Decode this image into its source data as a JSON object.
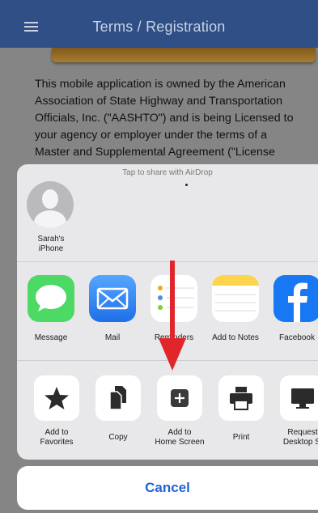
{
  "navbar": {
    "title": "Terms / Registration"
  },
  "terms": {
    "paragraph": "This mobile application is owned by the American Association of State Highway and Transportation Officials, Inc. (\"AASHTO\") and is being Licensed to your agency or employer under the terms of a Master and Supplemental Agreement (\"License"
  },
  "share_sheet": {
    "airdrop_title": "Tap to share with AirDrop",
    "contact": {
      "line1": "Sarah's",
      "line2": "iPhone"
    },
    "apps": [
      {
        "label": "Message",
        "color": "#4cd964"
      },
      {
        "label": "Mail",
        "color": "#2f7df6"
      },
      {
        "label": "Reminders",
        "color": "#ffffff"
      },
      {
        "label": "Add to Notes",
        "color": "#ffffff"
      },
      {
        "label": "Facebook",
        "color": "#1877f2"
      }
    ],
    "actions": [
      {
        "line1": "Add to",
        "line2": "Favorites"
      },
      {
        "line1": "Copy",
        "line2": ""
      },
      {
        "line1": "Add to",
        "line2": "Home Screen"
      },
      {
        "line1": "Print",
        "line2": ""
      },
      {
        "line1": "Request",
        "line2": "Desktop Si"
      }
    ],
    "cancel_label": "Cancel"
  },
  "annotation": {
    "arrow_color": "#e0262b"
  }
}
